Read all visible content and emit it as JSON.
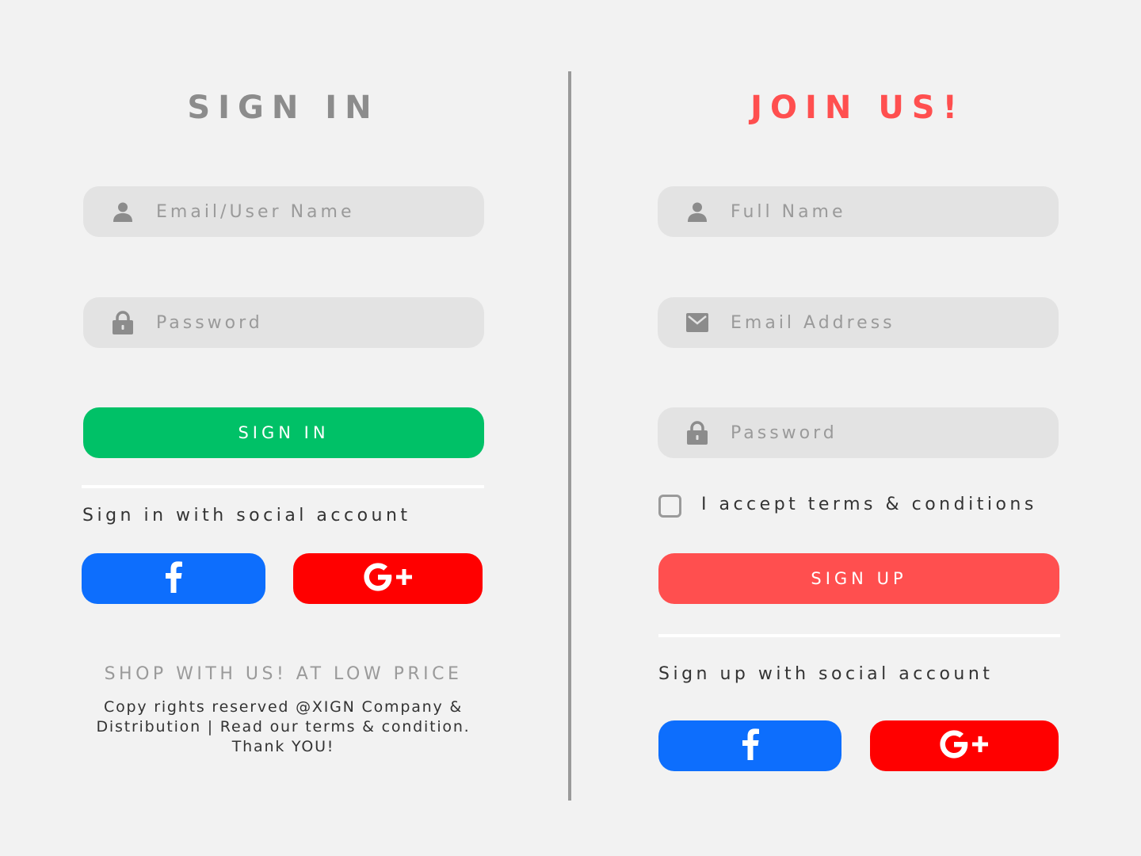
{
  "colors": {
    "background": "#f2f2f2",
    "field_bg": "#e3e3e3",
    "signin_green": "#00c167",
    "signup_red": "#ff4f4f",
    "facebook_blue": "#0d6efd",
    "google_red": "#ff0000",
    "icon_gray": "#8c8c8c"
  },
  "signin": {
    "title": "SIGN IN",
    "username_placeholder": "Email/User Name",
    "password_placeholder": "Password",
    "submit_label": "SIGN IN",
    "social_label": "Sign in with social account",
    "facebook_label": "f",
    "google_label": "G+",
    "promo": "SHOP WITH US! AT LOW PRICE",
    "copyright": "Copy rights reserved @XIGN Company & Distribution | Read our terms & condition. Thank YOU!"
  },
  "signup": {
    "title": "JOIN US!",
    "fullname_placeholder": "Full Name",
    "email_placeholder": "Email Address",
    "password_placeholder": "Password",
    "terms_label": "I accept terms & conditions",
    "submit_label": "SIGN UP",
    "social_label": "Sign up with social account",
    "facebook_label": "f",
    "google_label": "G+"
  },
  "icons": {
    "user": "user-icon",
    "lock": "lock-icon",
    "mail": "mail-icon",
    "facebook": "facebook-icon",
    "google_plus": "google-plus-icon"
  }
}
